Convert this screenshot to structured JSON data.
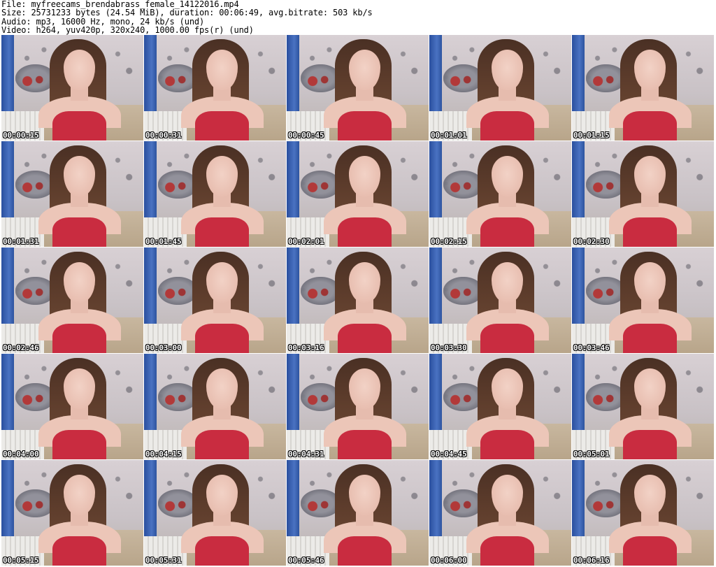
{
  "header": {
    "file": "File: myfreecams_brendabrass_female_14122016.mp4",
    "size": "Size: 25731233 bytes (24.54 MiB), duration: 00:06:49, avg.bitrate: 503 kb/s",
    "audio": "Audio: mp3, 16000 Hz, mono, 24 kb/s (und)",
    "video": "Video: h264, yuv420p, 320x240, 1000.00 fps(r) (und)"
  },
  "frames": [
    "00:00:15",
    "00:00:31",
    "00:00:45",
    "00:01:01",
    "00:01:15",
    "00:01:31",
    "00:01:45",
    "00:02:01",
    "00:02:15",
    "00:02:30",
    "00:02:46",
    "00:03:00",
    "00:03:16",
    "00:03:30",
    "00:03:46",
    "00:04:00",
    "00:04:15",
    "00:04:31",
    "00:04:45",
    "00:05:01",
    "00:05:15",
    "00:05:31",
    "00:05:46",
    "00:06:00",
    "00:06:16"
  ]
}
